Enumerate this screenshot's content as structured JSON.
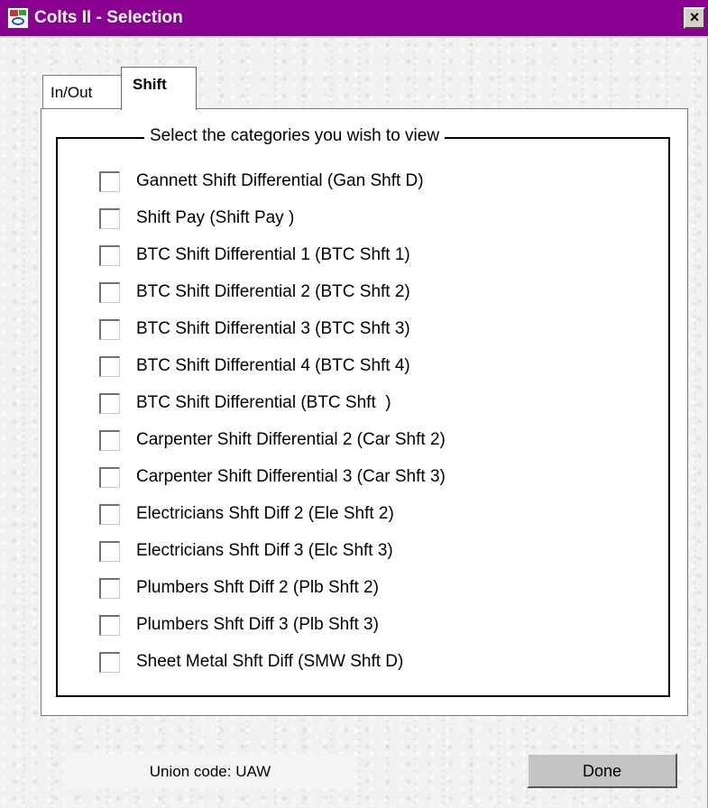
{
  "window": {
    "title": "Colts II - Selection",
    "close_label": "×",
    "titlebar_color": "#8a0090"
  },
  "tabs": [
    {
      "label": "In/Out",
      "active": false
    },
    {
      "label": "Shift",
      "active": true
    }
  ],
  "group": {
    "title": "Select the categories you wish to view"
  },
  "categories": [
    {
      "label": "Gannett Shift Differential (Gan Shft D)",
      "checked": false
    },
    {
      "label": "Shift Pay (Shift Pay )",
      "checked": false
    },
    {
      "label": "BTC Shift Differential 1 (BTC Shft 1)",
      "checked": false
    },
    {
      "label": "BTC Shift Differential 2 (BTC Shft 2)",
      "checked": false
    },
    {
      "label": "BTC Shift Differential 3 (BTC Shft 3)",
      "checked": false
    },
    {
      "label": "BTC Shift Differential 4 (BTC Shft 4)",
      "checked": false
    },
    {
      "label": "BTC Shift Differential (BTC Shft  )",
      "checked": false
    },
    {
      "label": "Carpenter Shift Differential 2 (Car Shft 2)",
      "checked": false
    },
    {
      "label": "Carpenter Shift Differential 3 (Car Shft 3)",
      "checked": false
    },
    {
      "label": "Electricians Shft Diff 2 (Ele Shft 2)",
      "checked": false
    },
    {
      "label": "Electricians Shft Diff 3 (Elc Shft 3)",
      "checked": false
    },
    {
      "label": "Plumbers Shft Diff 2 (Plb Shft 2)",
      "checked": false
    },
    {
      "label": "Plumbers Shft Diff 3 (Plb Shft 3)",
      "checked": false
    },
    {
      "label": "Sheet Metal Shft Diff (SMW Shft D)",
      "checked": false
    }
  ],
  "footer": {
    "union_code": "Union code: UAW",
    "done_label": "Done"
  }
}
